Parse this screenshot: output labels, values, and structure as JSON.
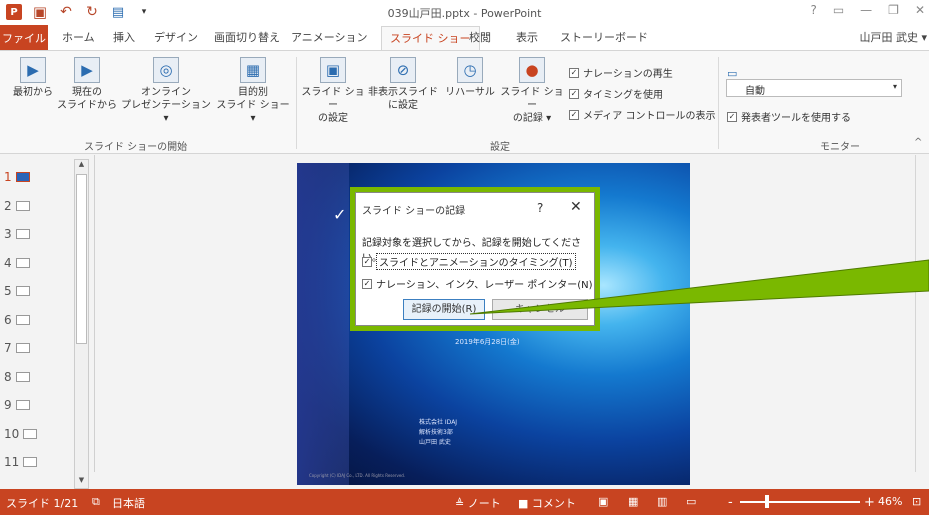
{
  "titlebar": {
    "title": "039山戸田.pptx - PowerPoint",
    "app_icon": "P",
    "help": "?",
    "ribbon_display": "▭",
    "minimize": "—",
    "restore": "❐",
    "close": "✕"
  },
  "tabs": {
    "file": "ファイル",
    "items": [
      "ホーム",
      "挿入",
      "デザイン",
      "画面切り替え",
      "アニメーション",
      "スライド ショー",
      "校閲",
      "表示",
      "ストーリーボード"
    ],
    "active": "スライド ショー",
    "user": "山戸田 武史 ▾"
  },
  "ribbon": {
    "start_group": {
      "label": "スライド ショーの開始",
      "buttons": {
        "from_beginning": "最初から",
        "from_current_l1": "現在の",
        "from_current_l2": "スライドから",
        "online_l1": "オンライン",
        "online_l2": "プレゼンテーション ▾",
        "custom_l1": "目的別",
        "custom_l2": "スライド ショー ▾"
      }
    },
    "setup_group": {
      "label": "設定",
      "buttons": {
        "setup_l1": "スライド ショー",
        "setup_l2": "の設定",
        "hide_l1": "非表示スライド",
        "hide_l2": "に設定",
        "rehearse": "リハーサル",
        "record_l1": "スライド ショー",
        "record_l2": "の記録 ▾"
      },
      "checkboxes": [
        "ナレーションの再生",
        "タイミングを使用",
        "メディア コントロールの表示"
      ]
    },
    "monitor_group": {
      "label": "モニター",
      "select_value": "自動",
      "presenter_view": "発表者ツールを使用する"
    }
  },
  "sidebar": {
    "slides": [
      "1",
      "2",
      "3",
      "4",
      "5",
      "6",
      "7",
      "8",
      "9",
      "10",
      "11"
    ],
    "active_index": 0
  },
  "slide": {
    "date": "2019年6月28日(金)",
    "company_l1": "株式会社 IDAJ",
    "company_l2": "解析技術3部",
    "company_l3": "山戸田 武史",
    "copyright": "Copyright (C) IDAJ Co., LTD. All Rights Reserved."
  },
  "dialog": {
    "title": "スライド ショーの記録",
    "help": "?",
    "close": "✕",
    "message": "記録対象を選択してから、記録を開始してください。",
    "check1": "スライドとアニメーションのタイミング(T)",
    "check2": "ナレーション、インク、レーザー ポインター(N)",
    "start_button": "記録の開始(R)",
    "cancel_button": "キャンセル"
  },
  "statusbar": {
    "slide_info": "スライド 1/21",
    "language": "日本語",
    "notes": "≜ ノート",
    "comments": "■ コメント",
    "zoom": "46%",
    "view_icons": [
      "normal-view-icon",
      "slide-sorter-icon",
      "reading-view-icon",
      "slideshow-icon"
    ],
    "zoom_level": 0.46
  },
  "colors": {
    "brand": "#c84421",
    "highlight": "#7ab800",
    "arrow": "#7ab800"
  }
}
